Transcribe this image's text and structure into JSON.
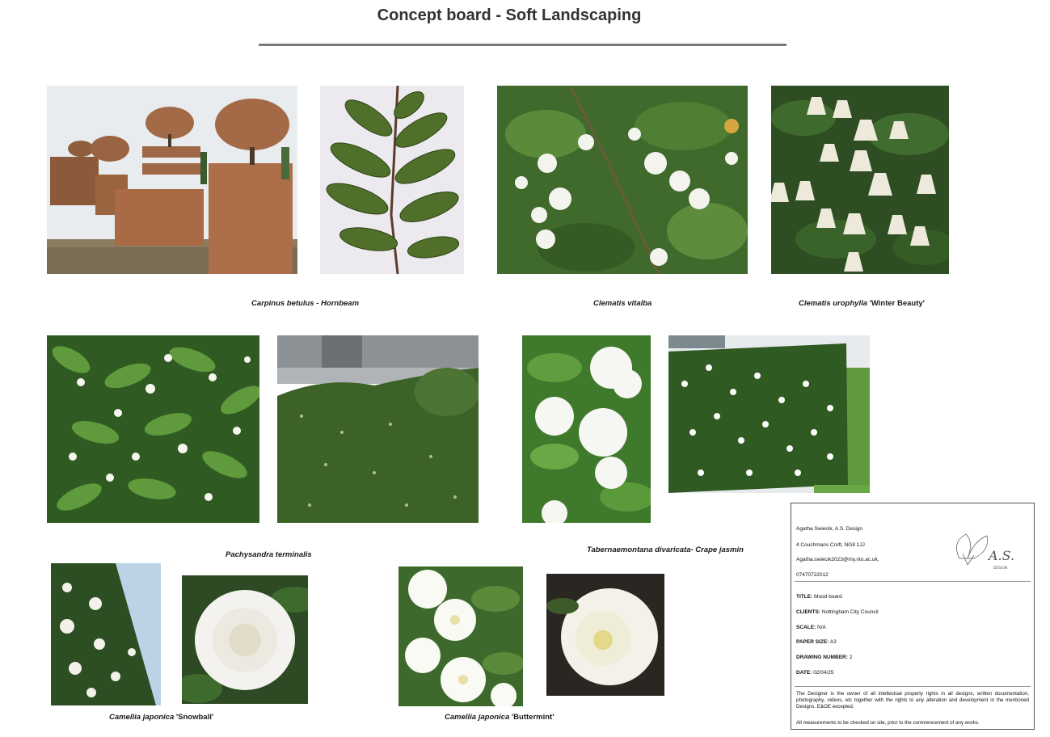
{
  "title": "Concept board - Soft Landscaping",
  "captions": {
    "hornbeam": {
      "latin": "Carpinus betulus",
      "common": " - Hornbeam"
    },
    "vitalba": {
      "latin": "Clematis vitalba",
      "common": ""
    },
    "urophylla": {
      "latin": "Clematis urophylla",
      "common": " 'Winter Beauty'"
    },
    "pachysandra": {
      "latin": "Pachysandra terminalis",
      "common": ""
    },
    "tabernaemontana": {
      "latin": "Tabernaemontana divaricata",
      "common": "- Crape jasmin"
    },
    "snowball": {
      "latin": "Camellia japonica",
      "common": " 'Snowball'"
    },
    "buttermint": {
      "latin": "Camellia japonica",
      "common": " 'Buttermint'"
    }
  },
  "title_block": {
    "designer": "Agatha Swiecik, A.S. Design",
    "address": "4 Couchmans Croft, NG8 1JJ",
    "email": "Agatha.swiecik2023@my.ntu.ac.uk,",
    "phone": "07470722012",
    "logo_text": "A.S.",
    "logo_sub": "DESIGN",
    "rows": [
      {
        "label": "TITLE:",
        "value": " Mood board"
      },
      {
        "label": "CLIENTS:",
        "value": " Nottingham City Council"
      },
      {
        "label": "SCALE:",
        "value": " N/A"
      },
      {
        "label": "PAPER SIZE:",
        "value": " A3"
      },
      {
        "label": "DRAWING NUMBER:",
        "value": " 2"
      },
      {
        "label": "DATE:",
        "value": " 02/04/25"
      }
    ],
    "notice": "The Designer is the owner of all intellectual property rights in all designs, written documentation, photography, videos, etc together with the rights to any alteration and development in the mentioned Designs. E&OE excepted.",
    "footnote": "All measurements to be checked on site, prior to the commencement of any works."
  }
}
